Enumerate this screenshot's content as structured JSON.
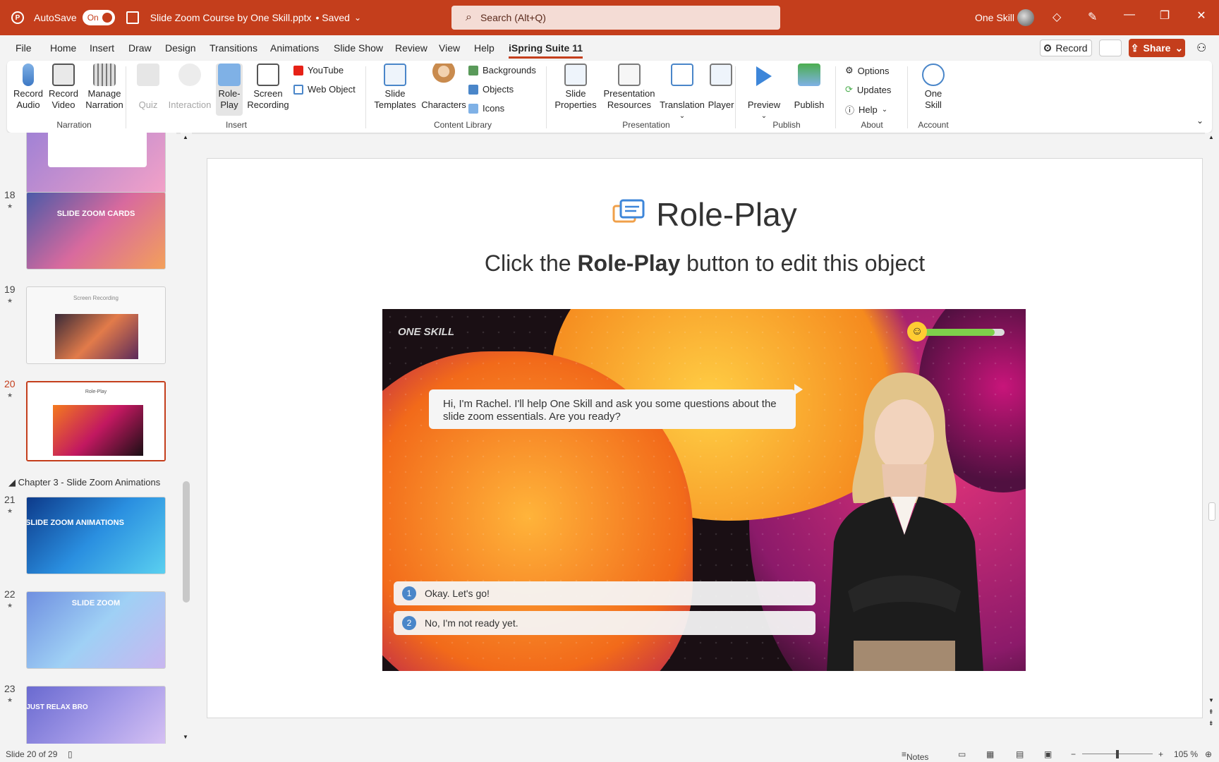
{
  "titlebar": {
    "autosave_label": "AutoSave",
    "autosave_state": "On",
    "document_title": "Slide Zoom Course by One Skill.pptx",
    "save_status": "• Saved",
    "search_placeholder": "Search (Alt+Q)",
    "user_name": "One Skill"
  },
  "menu": {
    "tabs": [
      "File",
      "Home",
      "Insert",
      "Draw",
      "Design",
      "Transitions",
      "Animations",
      "Slide Show",
      "Review",
      "View",
      "Help",
      "iSpring Suite 11"
    ],
    "active_tab": "iSpring Suite 11",
    "record_label": "Record",
    "share_label": "Share"
  },
  "ribbon": {
    "narration": {
      "group_label": "Narration",
      "record_audio": "Record\nAudio",
      "record_video": "Record\nVideo",
      "manage_narration": "Manage\nNarration"
    },
    "insert": {
      "group_label": "Insert",
      "quiz": "Quiz",
      "interaction": "Interaction",
      "role_play": "Role-\nPlay",
      "screen_recording": "Screen\nRecording",
      "youtube": "YouTube",
      "web_object": "Web Object"
    },
    "content_library": {
      "group_label": "Content Library",
      "slide_templates": "Slide\nTemplates",
      "characters": "Characters",
      "backgrounds": "Backgrounds",
      "objects": "Objects",
      "icons": "Icons"
    },
    "presentation": {
      "group_label": "Presentation",
      "slide_properties": "Slide\nProperties",
      "presentation_resources": "Presentation\nResources",
      "translation": "Translation",
      "player": "Player"
    },
    "publish": {
      "group_label": "Publish",
      "preview": "Preview",
      "publish": "Publish"
    },
    "about": {
      "group_label": "About",
      "options": "Options",
      "updates": "Updates",
      "help": "Help"
    },
    "account": {
      "group_label": "Account",
      "one_skill": "One\nSkill"
    }
  },
  "thumbnails": {
    "slide18": {
      "num": "18",
      "title": "SLIDE ZOOM CARDS"
    },
    "slide19": {
      "num": "19",
      "title": "Screen Recording"
    },
    "slide20": {
      "num": "20",
      "title": "Role-Play"
    },
    "section": "Chapter 3 - Slide Zoom Animations",
    "slide21": {
      "num": "21",
      "title": "SLIDE ZOOM ANIMATIONS"
    },
    "slide22": {
      "num": "22",
      "title": "SLIDE ZOOM"
    },
    "slide23": {
      "num": "23",
      "title": "JUST RELAX BRO"
    }
  },
  "slide": {
    "title": "Role-Play",
    "subtitle_pre": "Click the ",
    "subtitle_bold": "Role-Play",
    "subtitle_post": " button to edit this object",
    "brand": "ONE SKILL",
    "dialogue": "Hi, I'm Rachel. I'll help One Skill and ask you some questions about the slide zoom essentials. Are you ready?",
    "meter_fraction": 0.88,
    "answers": [
      {
        "num": "1",
        "text": "Okay. Let's go!"
      },
      {
        "num": "2",
        "text": "No, I'm not ready yet."
      }
    ]
  },
  "status": {
    "slide_info": "Slide 20 of 29",
    "notes": "Notes",
    "zoom": "105 %"
  },
  "colors": {
    "accent": "#c43e1c",
    "answer_badge": "#4a86c9",
    "meter": "#7ed04b"
  }
}
